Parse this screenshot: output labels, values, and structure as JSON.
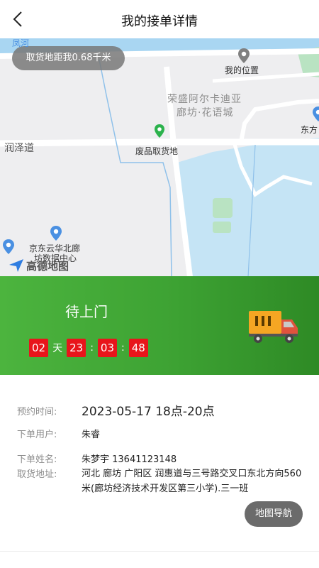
{
  "header": {
    "title": "我的接单详情"
  },
  "map": {
    "distance": "取货地距我0.68千米",
    "labels": {
      "river": "凤河",
      "my_location": "我的位置",
      "community_line1": "荣盛阿尔卡迪亚",
      "community_line2": "廊坊·花语城",
      "pickup": "废品取货地",
      "road": "润泽道",
      "east": "东方",
      "datacenter_line1": "京东云华北廊",
      "datacenter_line2": "坊数据中心",
      "provider": "高德地图"
    },
    "colors": {
      "water": "#a9d6f2",
      "green": "#b9e3c2",
      "road": "#ffffff",
      "pin_gray": "#808080",
      "pin_green": "#2bb24c",
      "pin_blue": "#4a90e2"
    }
  },
  "status": {
    "text": "待上门",
    "countdown": {
      "days": "02",
      "day_unit": "天",
      "hours": "23",
      "minutes": "03",
      "seconds": "48",
      "sep": ":"
    },
    "colors": {
      "bg": "#3da233",
      "digit_bg": "#e8151b"
    }
  },
  "details": {
    "time_label": "预约时间:",
    "time_value": "2023-05-17 18点-20点",
    "user_label": "下单用户:",
    "user_value": "朱睿",
    "name_label": "下单姓名:",
    "name_value": "朱梦宇 13641123148",
    "addr_label": "取货地址:",
    "addr_value": "河北 廊坊 广阳区 润惠道与三号路交叉口东北方向560米(廊坊经济技术开发区第三小学).三一班",
    "nav_button": "地图导航"
  }
}
